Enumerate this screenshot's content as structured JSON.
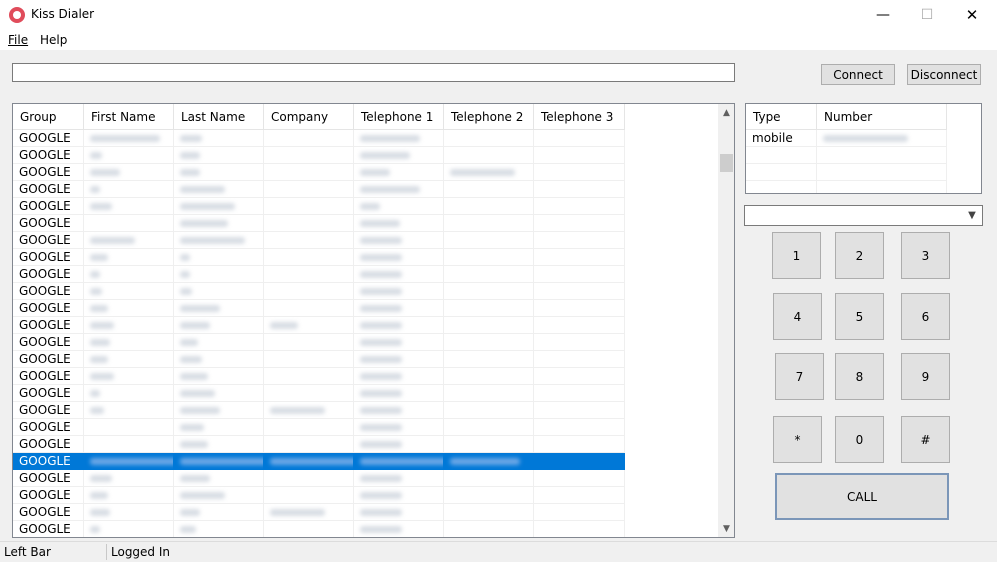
{
  "window": {
    "title": "Kiss Dialer",
    "minimize_glyph": "—",
    "maximize_glyph": "☐",
    "close_glyph": "✕"
  },
  "menu": [
    "File",
    "Help"
  ],
  "search": {
    "value": "",
    "placeholder": ""
  },
  "buttons": {
    "connect": "Connect",
    "disconnect": "Disconnect"
  },
  "contacts": {
    "columns": [
      "Group",
      "First Name",
      "Last Name",
      "Company",
      "Telephone 1",
      "Telephone 2",
      "Telephone 3"
    ],
    "group_values": [
      "GOOGLE",
      "GOOGLE",
      "GOOGLE",
      "GOOGLE",
      "GOOGLE",
      "GOOGLE",
      "GOOGLE",
      "GOOGLE",
      "GOOGLE",
      "GOOGLE",
      "GOOGLE",
      "GOOGLE",
      "GOOGLE",
      "GOOGLE",
      "GOOGLE",
      "GOOGLE",
      "GOOGLE",
      "GOOGLE",
      "GOOGLE",
      "GOOGLE",
      "GOOGLE",
      "GOOGLE",
      "GOOGLE",
      "GOOGLE"
    ],
    "selected_row": 19
  },
  "numbers": {
    "columns": [
      "Type",
      "Number"
    ],
    "rows": [
      {
        "type": "mobile",
        "number": ""
      }
    ]
  },
  "combo": {
    "value": ""
  },
  "keypad": [
    "1",
    "2",
    "3",
    "4",
    "5",
    "6",
    "7",
    "8",
    "9",
    "*",
    "0",
    "#"
  ],
  "call_label": "CALL",
  "status": {
    "left": "Left Bar",
    "right": "Logged In"
  },
  "colors": {
    "selection": "#0078d7",
    "app_icon": "#e04c5b"
  }
}
